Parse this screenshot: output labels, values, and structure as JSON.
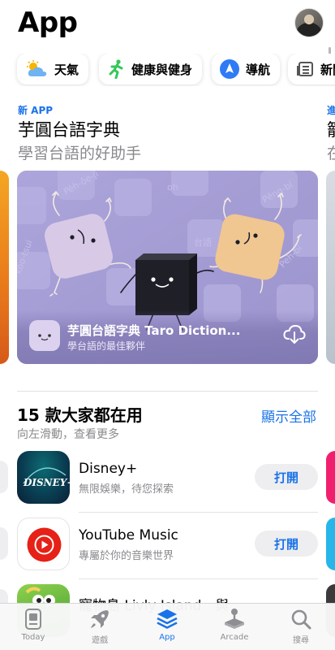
{
  "header": {
    "title": "App"
  },
  "categories": [
    {
      "label": "天氣",
      "icon": "weather-icon"
    },
    {
      "label": "健康與健身",
      "icon": "running-person-icon"
    },
    {
      "label": "導航",
      "icon": "navigation-arrow-icon"
    },
    {
      "label": "新聞",
      "icon": "newspaper-icon"
    }
  ],
  "featured": {
    "tag": "新 APP",
    "title": "芋圓台語字典",
    "subtitle": "學習台語的好助手",
    "app_name": "芋圓台語字典 Taro Diction...",
    "app_subtitle": "學台語的最佳夥伴",
    "art_words": [
      "Pe̍h-ōe-jī",
      "oh",
      "kóo-tsui",
      "台語",
      "Pēng-bí",
      "Peh-bi"
    ]
  },
  "next_featured": {
    "tag": "進",
    "title": "籠",
    "subtitle": "在"
  },
  "popular": {
    "title": "15 款大家都在用",
    "subtitle": "向左滑動，查看更多",
    "see_all": "顯示全部",
    "apps": [
      {
        "name": "Disney+",
        "subtitle": "無限娛樂，待您探索",
        "button": "打開"
      },
      {
        "name": "YouTube Music",
        "subtitle": "專屬於你的音樂世界",
        "button": "打開"
      },
      {
        "name": "寵物島 Livly Island　與",
        "subtitle": "",
        "button": ""
      }
    ],
    "disney_logo_text": "DISNEY+"
  },
  "tabs": [
    {
      "label": "Today",
      "icon": "today-icon",
      "active": false
    },
    {
      "label": "遊戲",
      "icon": "rocket-icon",
      "active": false
    },
    {
      "label": "App",
      "icon": "apps-stack-icon",
      "active": true
    },
    {
      "label": "Arcade",
      "icon": "joystick-icon",
      "active": false
    },
    {
      "label": "搜尋",
      "icon": "search-icon",
      "active": false
    }
  ],
  "colors": {
    "accent": "#1a73e8",
    "card_bg": "#a9a2d6"
  }
}
